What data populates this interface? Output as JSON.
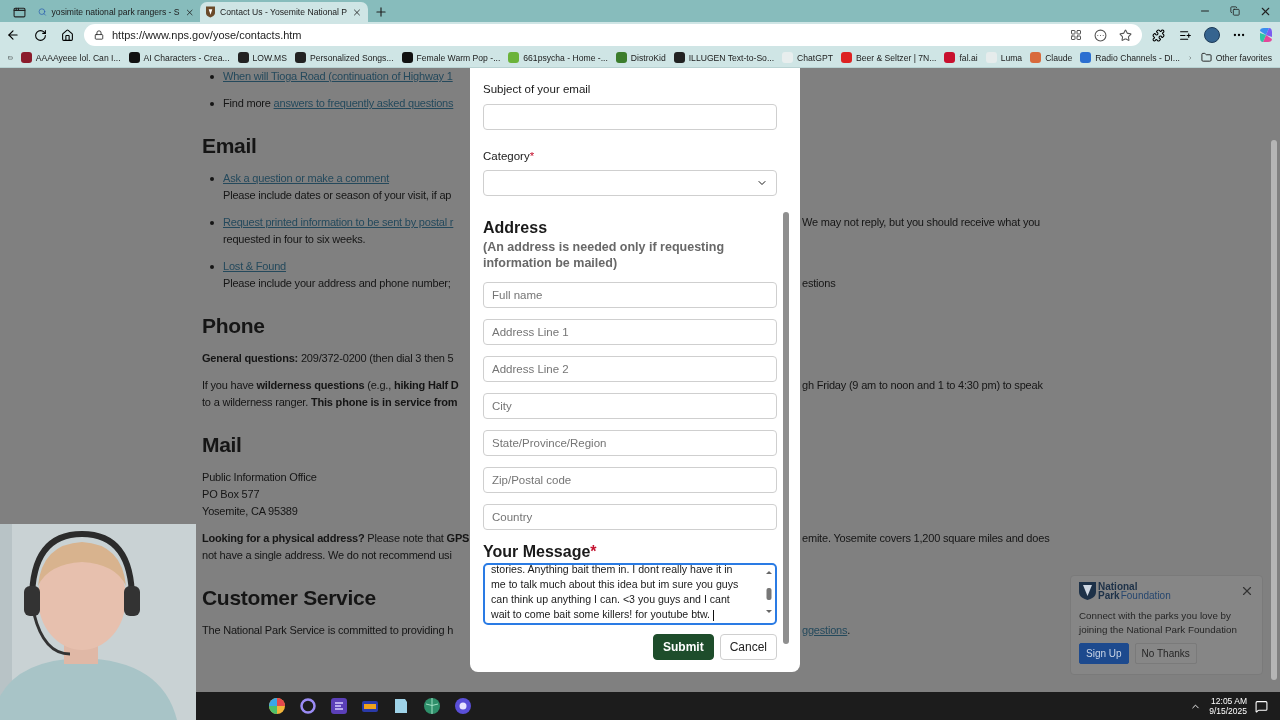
{
  "browser": {
    "tabs": [
      {
        "title": "yosimite national park rangers - S",
        "kind": "search",
        "selected": false
      },
      {
        "title": "Contact Us - Yosemite National P",
        "kind": "site",
        "selected": true
      }
    ],
    "url": "https://www.nps.gov/yose/contacts.htm",
    "bookmarks": [
      "AAAAyeee lol. Can I...",
      "AI Characters - Crea...",
      "LOW.MS",
      "Personalized Songs...",
      "Female Warm Pop -...",
      "661psycha - Home -...",
      "DistroKid",
      "ILLUGEN Text-to-So...",
      "ChatGPT",
      "Beer & Seltzer | 7N...",
      "fal.ai",
      "Luma",
      "Claude",
      "Radio Channels - DI..."
    ],
    "other_favorites": "Other favorites"
  },
  "page": {
    "blocks": [
      {
        "kind": "bullet",
        "lines": [
          {
            "left": [
              {
                "text": "When will Tioga Road (continuation of Highway 1",
                "link": true
              }
            ]
          }
        ]
      },
      {
        "kind": "bullet",
        "lines": [
          {
            "left": [
              {
                "text": "Find more ",
                "link": false
              },
              {
                "text": "answers to frequently asked questions",
                "link": true
              }
            ]
          }
        ]
      },
      {
        "kind": "heading",
        "text": "Email"
      },
      {
        "kind": "bullet",
        "lines": [
          {
            "left": [
              {
                "text": "Ask a question or make a comment",
                "link": true
              }
            ]
          },
          {
            "left": [
              {
                "text": "Please include dates or season of your visit, if ap",
                "link": false
              }
            ]
          }
        ]
      },
      {
        "kind": "bullet",
        "lines": [
          {
            "left": [
              {
                "text": "Request printed information to be sent by postal r",
                "link": true
              }
            ],
            "right": [
              {
                "text": "We may not reply, but you should receive what you",
                "link": false
              }
            ]
          },
          {
            "left": [
              {
                "text": "requested in four to six weeks.",
                "link": false
              }
            ]
          }
        ]
      },
      {
        "kind": "bullet",
        "lines": [
          {
            "left": [
              {
                "text": "Lost & Found",
                "link": true
              }
            ]
          },
          {
            "left": [
              {
                "text": "Please include your address and phone number;",
                "link": false
              }
            ],
            "right": [
              {
                "text": "estions",
                "link": false
              }
            ]
          }
        ]
      },
      {
        "kind": "heading",
        "text": "Phone"
      },
      {
        "kind": "para",
        "lines": [
          {
            "left": [
              {
                "text": "**General questions:** 209/372-0200 (then dial 3 then 5",
                "link": false
              }
            ]
          }
        ]
      },
      {
        "kind": "para",
        "lines": [
          {
            "left": [
              {
                "text": "If you have **wilderness questions** (e.g., **hiking Half D**",
                "link": false
              }
            ],
            "right": [
              {
                "text": "gh Friday (9 am to noon and 1 to 4:30 pm) to speak",
                "link": false
              }
            ]
          },
          {
            "left": [
              {
                "text": "to a wilderness ranger. **This phone is in service from**",
                "link": false
              }
            ]
          }
        ]
      },
      {
        "kind": "heading",
        "text": "Mail"
      },
      {
        "kind": "para",
        "lines": [
          {
            "left": [
              {
                "text": "Public Information Office",
                "link": false
              }
            ]
          },
          {
            "left": [
              {
                "text": "PO Box 577",
                "link": false
              }
            ]
          },
          {
            "left": [
              {
                "text": "Yosemite, CA 95389",
                "link": false
              }
            ]
          }
        ]
      },
      {
        "kind": "para",
        "lines": [
          {
            "left": [
              {
                "text": "**Looking for a physical address?** Please note that **GPS**",
                "link": false
              }
            ],
            "right": [
              {
                "text": "emite. Yosemite covers 1,200 square miles and does",
                "link": false
              }
            ]
          },
          {
            "left": [
              {
                "text": "not have a single address. We do not recommend usi",
                "link": false
              }
            ]
          }
        ]
      },
      {
        "kind": "heading",
        "text": "Customer Service"
      },
      {
        "kind": "para",
        "lines": [
          {
            "left": [
              {
                "text": "The National Park Service is committed to providing h",
                "link": false
              }
            ],
            "right": [
              {
                "text": "ggestions",
                "link": true
              },
              {
                "text": ".",
                "link": false
              }
            ]
          }
        ]
      }
    ]
  },
  "dialog": {
    "subject": {
      "label": "Subject of your email"
    },
    "category": {
      "label": "Category",
      "required_mark": "*"
    },
    "address": {
      "title": "Address",
      "note": "(An address is needed only if requesting information be mailed)",
      "fields": [
        {
          "placeholder": "Full name"
        },
        {
          "placeholder": "Address Line 1"
        },
        {
          "placeholder": "Address Line 2"
        },
        {
          "placeholder": "City"
        },
        {
          "placeholder": "State/Province/Region"
        },
        {
          "placeholder": "Zip/Postal code"
        },
        {
          "placeholder": "Country"
        }
      ]
    },
    "message": {
      "label": "Your Message",
      "required_mark": "*",
      "focused": true,
      "value_lines": [
        "stories. Anything bait them in. I dont really have it in",
        "me to talk much about this idea but im sure you guys",
        "can think up anything I can. <3 you guys and I cant",
        "wait to come bait some killers! for youtube btw."
      ]
    },
    "buttons": [
      {
        "label": "Submit",
        "kind": "primary"
      },
      {
        "label": "Cancel",
        "kind": "secondary"
      }
    ]
  },
  "promo": {
    "logo_top": "National",
    "logo_park": "Park",
    "logo_foundation": "Foundation",
    "text": "Connect with the parks you love by joining the National Park Foundation",
    "buttons": [
      {
        "label": "Sign Up",
        "kind": "primary"
      },
      {
        "label": "No Thanks",
        "kind": "secondary"
      }
    ]
  },
  "taskbar": {
    "time": "12:05 AM",
    "date": "9/15/2025"
  }
}
